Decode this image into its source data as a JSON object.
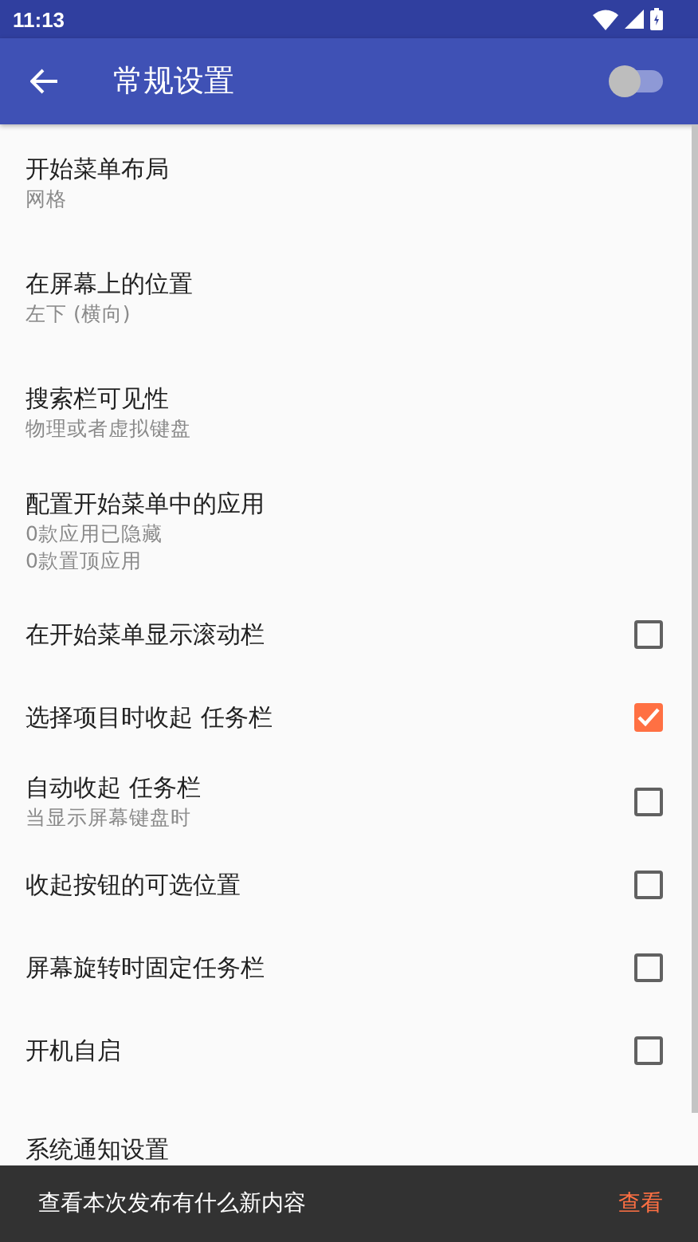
{
  "status_bar": {
    "time": "11:13"
  },
  "toolbar": {
    "title": "常规设置",
    "switch": {
      "on": false
    }
  },
  "settings": [
    {
      "kind": "text",
      "title": "开始菜单布局",
      "summary": [
        "网格"
      ]
    },
    {
      "kind": "text",
      "title": "在屏幕上的位置",
      "summary": [
        "左下 (横向)"
      ]
    },
    {
      "kind": "text",
      "title": "搜索栏可见性",
      "summary": [
        "物理或者虚拟键盘"
      ]
    },
    {
      "kind": "text",
      "title": "配置开始菜单中的应用",
      "summary": [
        "0款应用已隐藏",
        "0款置顶应用"
      ]
    },
    {
      "kind": "checkbox",
      "title": "在开始菜单显示滚动栏",
      "checked": false
    },
    {
      "kind": "checkbox",
      "title": "选择项目时收起 任务栏",
      "checked": true
    },
    {
      "kind": "checkbox",
      "title": "自动收起 任务栏",
      "summary": [
        "当显示屏幕键盘时"
      ],
      "checked": false
    },
    {
      "kind": "checkbox",
      "title": "收起按钮的可选位置",
      "checked": false
    },
    {
      "kind": "checkbox",
      "title": "屏幕旋转时固定任务栏",
      "checked": false
    },
    {
      "kind": "checkbox",
      "title": "开机自启",
      "checked": false
    },
    {
      "kind": "text",
      "title": "系统通知设置"
    }
  ],
  "snackbar": {
    "message": "查看本次发布有什么新内容",
    "action": "查看"
  }
}
